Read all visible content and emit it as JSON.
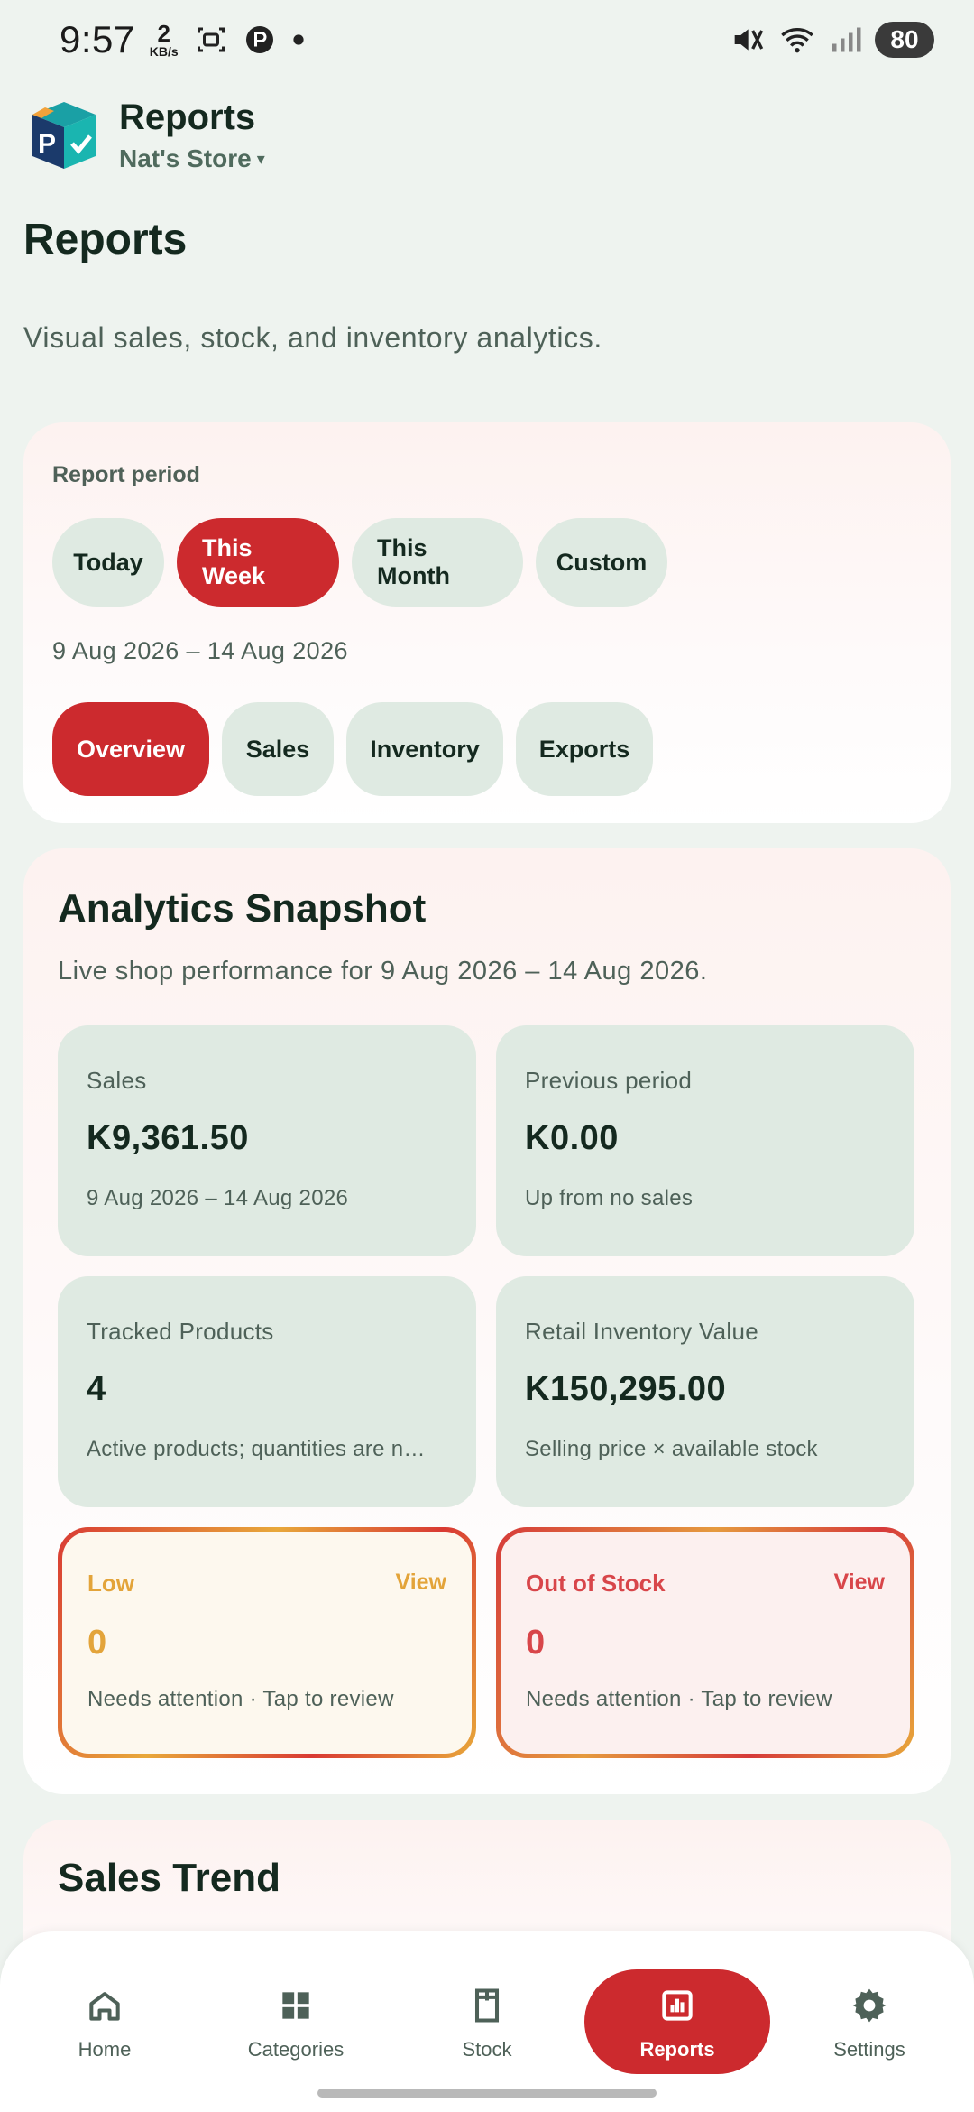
{
  "status_bar": {
    "time": "9:57",
    "speed_value": "2",
    "speed_unit": "KB/s",
    "battery": "80",
    "icons": [
      "screenshot-icon",
      "parking-icon",
      "dot-icon",
      "mute-icon",
      "wifi-icon",
      "signal-icon"
    ]
  },
  "app": {
    "title": "Reports",
    "store": "Nat's Store",
    "brand_colors": {
      "accent": "#cc2a2e",
      "chip": "#dfeae2",
      "teal": "#1a9aa3",
      "navy": "#1b3a6b"
    }
  },
  "page": {
    "title": "Reports",
    "subtitle": "Visual sales, stock, and inventory analytics."
  },
  "period": {
    "label": "Report period",
    "options": [
      "Today",
      "This Week",
      "This Month",
      "Custom"
    ],
    "selected": "This Week",
    "range": "9 Aug 2026 – 14 Aug 2026"
  },
  "tabs": {
    "items": [
      "Overview",
      "Sales",
      "Inventory",
      "Exports"
    ],
    "selected": "Overview"
  },
  "analytics": {
    "title": "Analytics Snapshot",
    "subtitle": "Live shop performance for 9 Aug 2026 – 14 Aug 2026.",
    "tiles": [
      {
        "label": "Sales",
        "value": "K9,361.50",
        "note": "9 Aug 2026 – 14 Aug 2026"
      },
      {
        "label": "Previous period",
        "value": "K0.00",
        "note": "Up from no sales"
      },
      {
        "label": "Tracked Products",
        "value": "4",
        "note": "Active products; quantities are n…"
      },
      {
        "label": "Retail Inventory Value",
        "value": "K150,295.00",
        "note": "Selling price × available stock"
      }
    ],
    "alerts": [
      {
        "label": "Low",
        "action": "View",
        "value": "0",
        "note": "Needs attention · Tap to review",
        "color": "#e3a43a"
      },
      {
        "label": "Out of Stock",
        "action": "View",
        "value": "0",
        "note": "Needs attention · Tap to review",
        "color": "#d8464a"
      }
    ]
  },
  "trend": {
    "title": "Sales Trend"
  },
  "nav": {
    "items": [
      {
        "label": "Home",
        "icon": "home-icon"
      },
      {
        "label": "Categories",
        "icon": "grid-icon"
      },
      {
        "label": "Stock",
        "icon": "box-icon"
      },
      {
        "label": "Reports",
        "icon": "bar-chart-icon"
      },
      {
        "label": "Settings",
        "icon": "gear-icon"
      }
    ],
    "selected": "Reports"
  }
}
